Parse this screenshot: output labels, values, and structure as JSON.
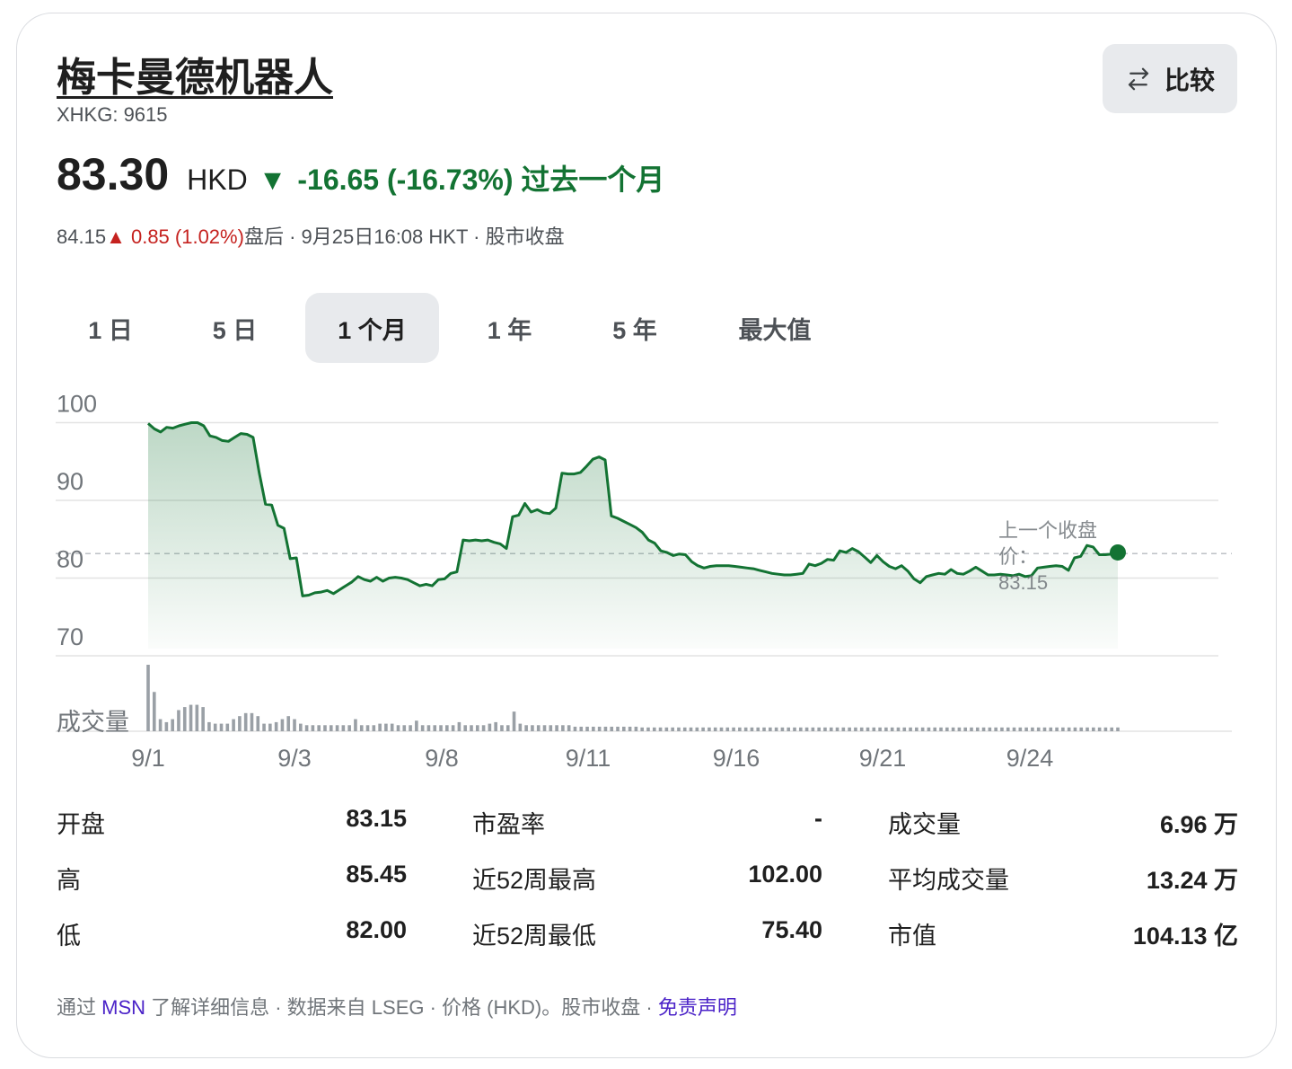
{
  "title": "梅卡曼德机器人",
  "ticker": "XHKG: 9615",
  "compare_label": "比较",
  "price": "83.30",
  "currency": "HKD",
  "change_arrow": "▼",
  "change_text": "-16.65 (-16.73%) 过去一个月",
  "after_hours": {
    "price": "84.15",
    "arrow": "▲",
    "change": "0.85 (1.02%)",
    "label": "盘后",
    "timestamp": "9月25日16:08 HKT",
    "status": "股市收盘"
  },
  "tabs": [
    {
      "label": "1 日",
      "active": false
    },
    {
      "label": "5 日",
      "active": false
    },
    {
      "label": "1 个月",
      "active": true
    },
    {
      "label": "1 年",
      "active": false
    },
    {
      "label": "5 年",
      "active": false
    },
    {
      "label": "最大值",
      "active": false
    }
  ],
  "chart_data": {
    "type": "area",
    "x_tick_labels": [
      "9/1",
      "9/3",
      "9/8",
      "9/11",
      "9/16",
      "9/21",
      "9/24"
    ],
    "y_ticks": [
      100,
      90,
      80,
      70
    ],
    "ylim": [
      68,
      101
    ],
    "prev_close_label": "上一个收盘价：",
    "prev_close_value": 83.15,
    "volume_label": "成交量",
    "line_color": "#137333",
    "series": [
      {
        "values": [
          99.9,
          99.2,
          98.8,
          99.4,
          99.3,
          99.6,
          99.8,
          100.0,
          100.0,
          99.6,
          98.3,
          98.1,
          97.7,
          97.6,
          98.1,
          98.6,
          98.5,
          98.1,
          93.5,
          89.5,
          89.4,
          86.8,
          86.4,
          82.5,
          82.6,
          77.7,
          77.8,
          78.1,
          78.2,
          78.4,
          78.0,
          78.5,
          79.0,
          79.5,
          80.2,
          79.8,
          79.6,
          80.1,
          79.6,
          80.0,
          80.1,
          80.0,
          79.8,
          79.4,
          79.0,
          79.2,
          79.0,
          79.8,
          79.9,
          80.6,
          80.8,
          84.9,
          84.8,
          84.9,
          84.8,
          84.9,
          84.6,
          84.4,
          83.8,
          87.9,
          88.1,
          89.6,
          88.5,
          88.8,
          88.4,
          88.3,
          89.0,
          93.5,
          93.4,
          93.4,
          93.6,
          94.4,
          95.3,
          95.6,
          95.2,
          88.0,
          87.7,
          87.3,
          86.9,
          86.5,
          85.9,
          84.9,
          84.5,
          83.5,
          83.3,
          82.9,
          83.1,
          83.0,
          82.1,
          81.6,
          81.3,
          81.5,
          81.6,
          81.6,
          81.6,
          81.5,
          81.4,
          81.3,
          81.2,
          81.0,
          80.8,
          80.6,
          80.5,
          80.4,
          80.4,
          80.5,
          80.6,
          81.8,
          81.6,
          81.9,
          82.4,
          82.3,
          83.5,
          83.3,
          83.8,
          83.4,
          82.7,
          82.0,
          82.9,
          82.1,
          81.5,
          81.2,
          81.6,
          80.9,
          79.9,
          79.4,
          80.2,
          80.4,
          80.6,
          80.5,
          81.1,
          80.6,
          80.5,
          80.9,
          81.4,
          80.9,
          80.4,
          80.4,
          80.5,
          80.4,
          80.3,
          80.5,
          80.2,
          80.3,
          81.3,
          81.4,
          81.5,
          81.6,
          81.5,
          81.0,
          82.6,
          82.8,
          84.2,
          84.0,
          83.0,
          83.0,
          83.1,
          83.3
        ]
      }
    ],
    "volume": [
      88,
      52,
      16,
      12,
      16,
      28,
      32,
      35,
      35,
      32,
      12,
      10,
      10,
      10,
      16,
      20,
      24,
      24,
      20,
      10,
      10,
      12,
      16,
      20,
      16,
      10,
      8,
      8,
      8,
      8,
      8,
      8,
      8,
      8,
      16,
      8,
      8,
      8,
      10,
      10,
      10,
      8,
      8,
      8,
      14,
      8,
      8,
      8,
      8,
      8,
      8,
      12,
      8,
      8,
      8,
      8,
      10,
      12,
      8,
      8,
      26,
      10,
      8,
      8,
      8,
      8,
      8,
      8,
      8,
      8,
      6,
      6,
      6,
      6,
      6,
      6,
      6,
      6,
      6,
      6,
      6,
      5,
      5,
      5,
      5,
      5,
      5,
      5,
      5,
      5,
      5,
      5,
      5,
      5,
      5,
      5,
      5,
      5,
      5,
      5,
      5,
      5,
      5,
      5,
      5,
      5,
      5,
      5,
      5,
      5,
      5,
      5,
      5,
      5,
      5,
      5,
      5,
      5,
      5,
      5,
      5,
      5,
      5,
      5,
      5,
      5,
      5,
      5,
      5,
      5,
      5,
      5,
      5,
      5,
      5,
      5,
      5,
      5,
      5,
      5,
      5,
      5,
      5,
      5,
      5,
      5,
      5,
      5,
      5,
      5,
      5,
      5,
      5,
      5,
      5,
      5,
      5,
      5,
      5,
      5
    ]
  },
  "stats": [
    {
      "label": "开盘",
      "value": "83.15"
    },
    {
      "label": "高",
      "value": "85.45"
    },
    {
      "label": "低",
      "value": "82.00"
    },
    {
      "label": "市盈率",
      "value": "-"
    },
    {
      "label": "近52周最高",
      "value": "102.00"
    },
    {
      "label": "近52周最低",
      "value": "75.40"
    },
    {
      "label": "成交量",
      "value": "6.96 万"
    },
    {
      "label": "平均成交量",
      "value": "13.24 万"
    },
    {
      "label": "市值",
      "value": "104.13 亿"
    }
  ],
  "footer": {
    "prefix": "通过 ",
    "msn": "MSN",
    "middle": " 了解详细信息 · 数据来自 LSEG · 价格 (HKD)。股市收盘 · ",
    "disclaimer": "免责声明"
  }
}
